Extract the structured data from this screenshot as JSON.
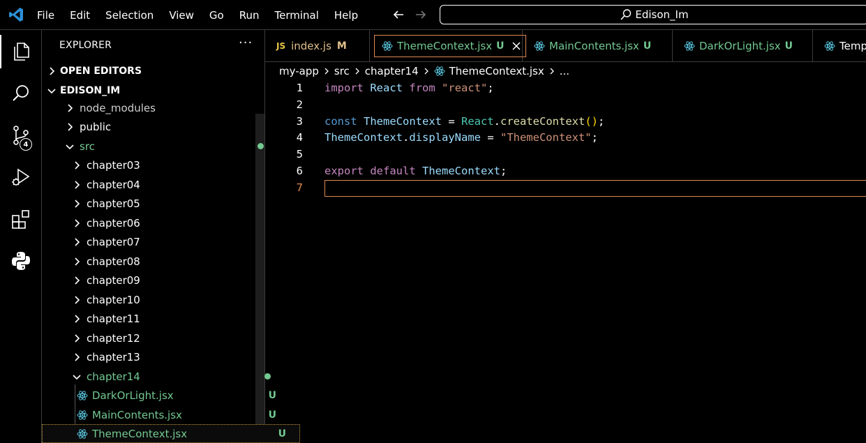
{
  "menu": [
    "File",
    "Edit",
    "Selection",
    "View",
    "Go",
    "Run",
    "Terminal",
    "Help"
  ],
  "search": {
    "text": "Edison_Im"
  },
  "activity": {
    "scm_badge": "4"
  },
  "sidebar": {
    "title": "EXPLORER",
    "more": "···",
    "open_editors": "OPEN EDITORS",
    "root": "EDISON_IM",
    "items": [
      {
        "label": "node_modules"
      },
      {
        "label": "public"
      },
      {
        "label": "src"
      },
      {
        "label": "chapter03"
      },
      {
        "label": "chapter04"
      },
      {
        "label": "chapter05"
      },
      {
        "label": "chapter06"
      },
      {
        "label": "chapter07"
      },
      {
        "label": "chapter08"
      },
      {
        "label": "chapter09"
      },
      {
        "label": "chapter10"
      },
      {
        "label": "chapter11"
      },
      {
        "label": "chapter12"
      },
      {
        "label": "chapter13"
      },
      {
        "label": "chapter14"
      },
      {
        "label": "DarkOrLight.jsx",
        "status": "U"
      },
      {
        "label": "MainContents.jsx",
        "status": "U"
      },
      {
        "label": "ThemeContext.jsx",
        "status": "U"
      }
    ]
  },
  "tabs": [
    {
      "label": "index.js",
      "status": "M"
    },
    {
      "label": "ThemeContext.jsx",
      "status": "U"
    },
    {
      "label": "MainContents.jsx",
      "status": "U"
    },
    {
      "label": "DarkOrLight.jsx",
      "status": "U"
    },
    {
      "label": "Temp"
    }
  ],
  "breadcrumb": [
    "my-app",
    "src",
    "chapter14",
    "ThemeContext.jsx",
    "..."
  ],
  "editor": {
    "line_numbers": [
      "1",
      "2",
      "3",
      "4",
      "5",
      "6",
      "7"
    ],
    "line1": {
      "t1": "import",
      "t2": "React",
      "t3": "from",
      "t4": "\"react\"",
      "t5": ";"
    },
    "line3": {
      "t1": "const",
      "t2": "ThemeContext",
      "t3": " = ",
      "t4": "React",
      "t5": ".",
      "t6": "createContext",
      "t7": "()",
      "t8": ";"
    },
    "line4": {
      "t1": "ThemeContext",
      "t2": ".",
      "t3": "displayName",
      "t4": " = ",
      "t5": "\"ThemeContext\"",
      "t6": ";"
    },
    "line6": {
      "t1": "export",
      "t2": "default",
      "t3": "ThemeContext",
      "t4": ";"
    }
  },
  "colors": {
    "accent": "#e08a52",
    "git_untracked": "#73c991",
    "git_modified": "#e2c08d"
  }
}
